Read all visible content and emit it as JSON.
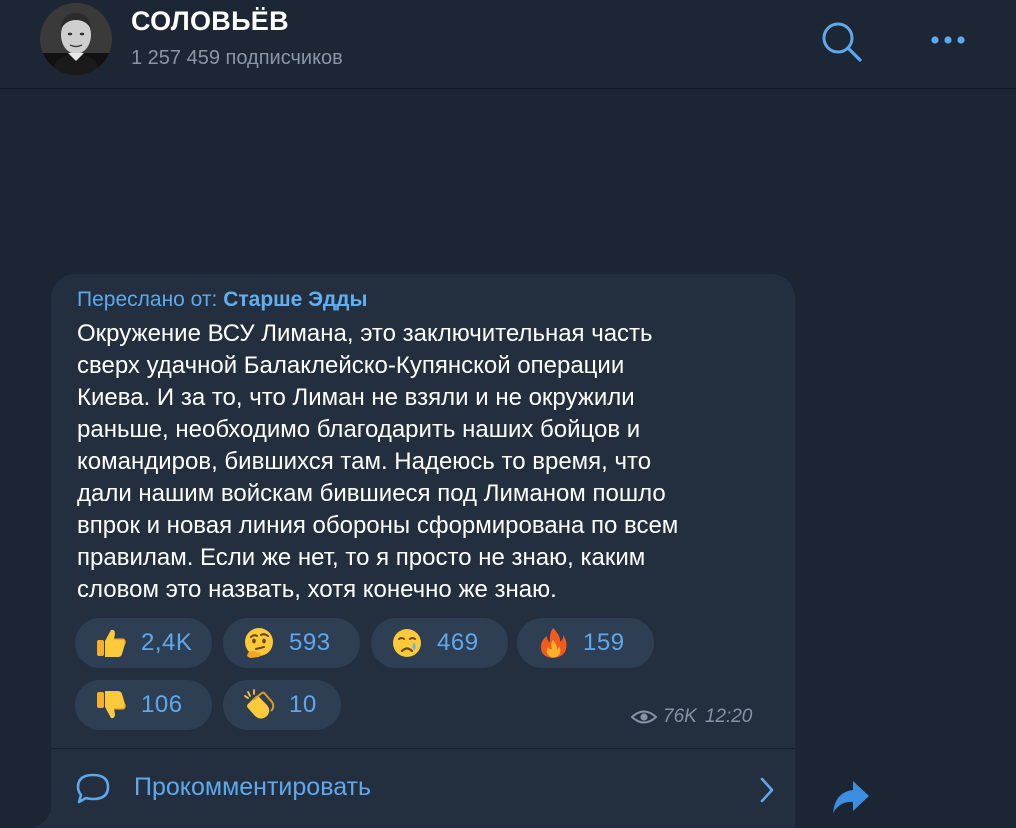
{
  "header": {
    "title": "СОЛОВЬЁВ",
    "subscribers": "1 257 459 подписчиков"
  },
  "message": {
    "forward_prefix": "Переслано от:",
    "forward_from": "Старше Эдды",
    "text_lines": [
      "Окружение ВСУ Лимана, это заключительная часть",
      "сверх удачной Балаклейско-Купянской операции",
      "Киева. И за то, что Лиман не взяли и не  окружили",
      "раньше, необходимо благодарить наших бойцов и",
      "командиров, бившихся там. Надеюсь то время, что",
      "дали нашим войскам бившиеся под Лиманом пошло",
      "впрок и новая линия обороны сформирована по всем",
      "правилам. Если же нет, то я просто не знаю, каким",
      "словом это назвать, хотя конечно же знаю."
    ],
    "reactions": [
      {
        "emoji": "thumbs-up",
        "count": "2,4K"
      },
      {
        "emoji": "thinking-face",
        "count": "593"
      },
      {
        "emoji": "crying-face",
        "count": "469"
      },
      {
        "emoji": "fire",
        "count": "159"
      },
      {
        "emoji": "thumbs-down",
        "count": "106"
      },
      {
        "emoji": "clapping-hands",
        "count": "10"
      }
    ],
    "views": "76K",
    "time": "12:20"
  },
  "comments": {
    "label": "Прокомментировать"
  },
  "colors": {
    "background": "#1c2533",
    "bubble": "#232f3e",
    "reaction_pill": "#2f3f53",
    "accent": "#5ea9ee",
    "meta": "#8593a4"
  }
}
